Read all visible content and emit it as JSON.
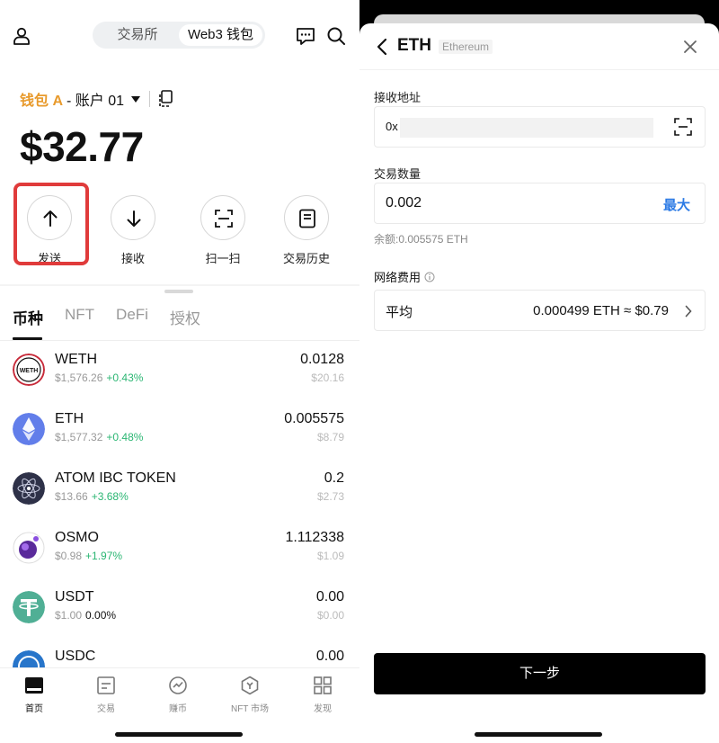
{
  "left": {
    "segment": {
      "exchange": "交易所",
      "web3": "Web3 钱包"
    },
    "wallet": {
      "name": "钱包 A",
      "account": "- 账户 01"
    },
    "balance": "$32.77",
    "actions": {
      "send": "发送",
      "receive": "接收",
      "scan": "扫一扫",
      "history": "交易历史"
    },
    "tabs": [
      "币种",
      "NFT",
      "DeFi",
      "授权"
    ],
    "tokens": [
      {
        "name": "WETH",
        "price": "$1,576.26",
        "change": "+0.43%",
        "amount": "0.0128",
        "usd": "$20.16",
        "icon": "weth-icon"
      },
      {
        "name": "ETH",
        "price": "$1,577.32",
        "change": "+0.48%",
        "amount": "0.005575",
        "usd": "$8.79",
        "icon": "eth-icon"
      },
      {
        "name": "ATOM IBC TOKEN",
        "price": "$13.66",
        "change": "+3.68%",
        "amount": "0.2",
        "usd": "$2.73",
        "icon": "atom-icon"
      },
      {
        "name": "OSMO",
        "price": "$0.98",
        "change": "+1.97%",
        "amount": "1.112338",
        "usd": "$1.09",
        "icon": "osmo-icon"
      },
      {
        "name": "USDT",
        "price": "$1.00",
        "change": "0.00%",
        "amount": "0.00",
        "usd": "$0.00",
        "icon": "usdt-icon"
      },
      {
        "name": "USDC",
        "price": "",
        "change": "",
        "amount": "0.00",
        "usd": "",
        "icon": "usdc-icon"
      }
    ],
    "nav": [
      "首页",
      "交易",
      "赚币",
      "NFT 市场",
      "发现"
    ]
  },
  "right": {
    "title": "ETH",
    "subtitle": "Ethereum",
    "address_label": "接收地址",
    "address_prefix": "0x",
    "amount_label": "交易数量",
    "amount_value": "0.002",
    "max_label": "最大",
    "balance_note": "余额:0.005575 ETH",
    "fee_label": "网络费用",
    "fee_name": "平均",
    "fee_value": "0.000499 ETH ≈ $0.79",
    "next_label": "下一步"
  },
  "colors": {
    "accent_orange": "#e89a2c",
    "positive_green": "#2bb673",
    "link_blue": "#2d7be5",
    "highlight_red": "#e03b3b"
  }
}
